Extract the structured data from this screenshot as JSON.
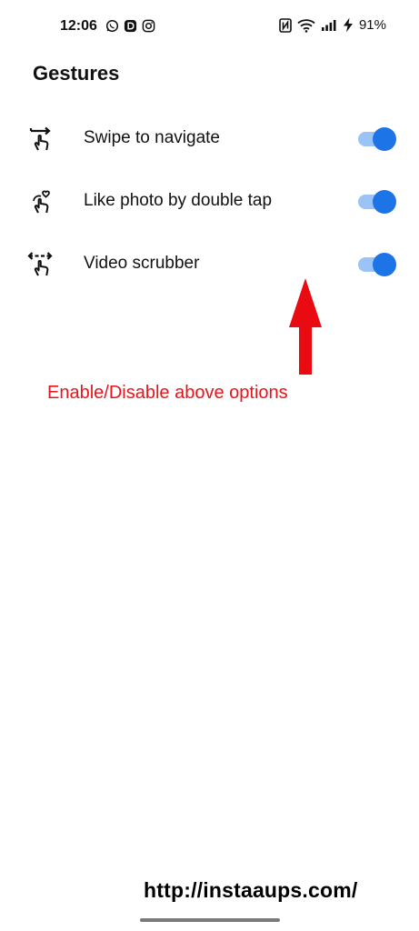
{
  "status_bar": {
    "time": "12:06",
    "left_icons": [
      "whatsapp-icon",
      "d-app-icon",
      "instagram-icon"
    ],
    "right_icons": [
      "nfc-icon",
      "wifi-icon",
      "signal-icon",
      "charging-icon"
    ],
    "battery": "91%"
  },
  "page": {
    "title": "Gestures"
  },
  "settings": [
    {
      "icon": "swipe-gesture-icon",
      "label": "Swipe to navigate",
      "enabled": true
    },
    {
      "icon": "double-tap-like-icon",
      "label": "Like photo by double tap",
      "enabled": true
    },
    {
      "icon": "scrub-gesture-icon",
      "label": "Video scrubber",
      "enabled": true
    }
  ],
  "annotation": {
    "text": "Enable/Disable above options",
    "color": "#e8141c"
  },
  "watermark": {
    "text": "http://instaaups.com/"
  },
  "colors": {
    "toggle_thumb": "#1c74e6",
    "toggle_track": "#9cc3f5"
  }
}
